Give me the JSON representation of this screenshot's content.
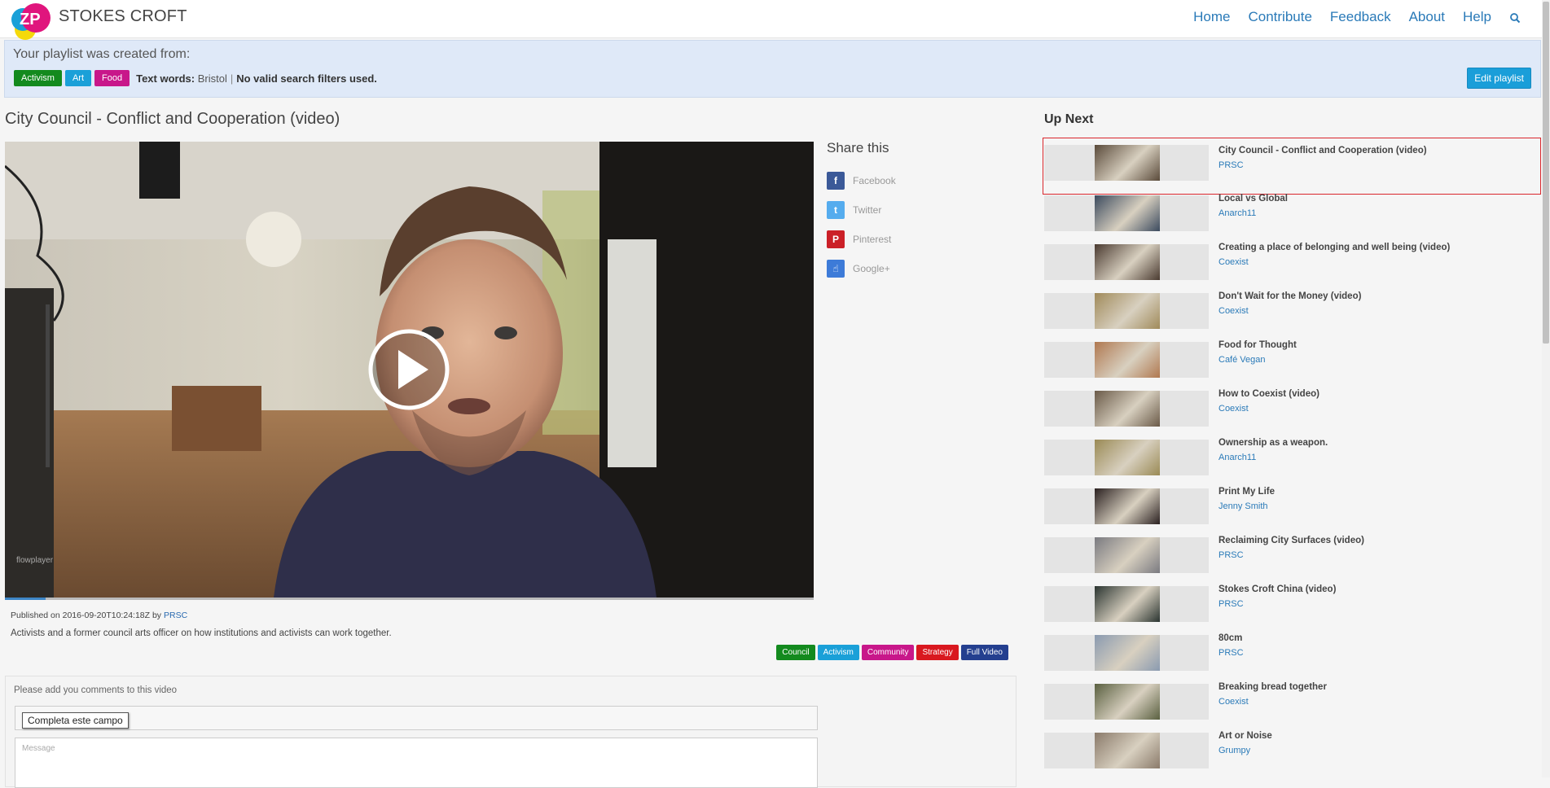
{
  "nav": {
    "brand": "STOKES CROFT",
    "links": [
      "Home",
      "Contribute",
      "Feedback",
      "About",
      "Help"
    ],
    "search_icon": "search-icon"
  },
  "banner": {
    "title": "Your playlist was created from:",
    "tags": [
      {
        "label": "Activism",
        "color": "#138a1e"
      },
      {
        "label": "Art",
        "color": "#1aa0d8"
      },
      {
        "label": "Food",
        "color": "#c8178a"
      }
    ],
    "text_words_label": "Text words:",
    "text_words_value": "Bristol",
    "separator": "|",
    "filters_note": "No valid search filters used.",
    "edit_label": "Edit playlist"
  },
  "video": {
    "title": "City Council - Conflict and Cooperation (video)",
    "watermark": "flowplayer",
    "progress": 0.05,
    "published_prefix": "Published on 2016-09-20T10:24:18Z by",
    "author": "PRSC",
    "description": "Activists and a former council arts officer on how institutions and activists can work together.",
    "tags": [
      {
        "label": "Council",
        "color": "#138a1e"
      },
      {
        "label": "Activism",
        "color": "#1aa0d8"
      },
      {
        "label": "Community",
        "color": "#c8178a"
      },
      {
        "label": "Strategy",
        "color": "#d9181f"
      },
      {
        "label": "Full Video",
        "color": "#243f8f"
      }
    ]
  },
  "share": {
    "title": "Share this",
    "items": [
      {
        "label": "Facebook",
        "icon": "facebook-icon",
        "glyph": "f",
        "color": "#3b5998"
      },
      {
        "label": "Twitter",
        "icon": "twitter-icon",
        "glyph": "t",
        "color": "#55acee"
      },
      {
        "label": "Pinterest",
        "icon": "pinterest-icon",
        "glyph": "P",
        "color": "#cb2027"
      },
      {
        "label": "Google+",
        "icon": "thumbs-up-icon",
        "glyph": "☝",
        "color": "#3d7bd8"
      }
    ]
  },
  "comments": {
    "label": "Please add you comments to this video",
    "tooltip": "Completa este campo",
    "message_placeholder": "Message"
  },
  "upnext": {
    "title": "Up Next",
    "items": [
      {
        "title": "City Council - Conflict and Cooperation (video)",
        "author": "PRSC",
        "active": true,
        "thumb": "#5a4a3a"
      },
      {
        "title": "Local vs Global",
        "author": "Anarch11",
        "active": false,
        "thumb": "#3b4a5e"
      },
      {
        "title": "Creating a place of belonging and well being (video)",
        "author": "Coexist",
        "active": false,
        "thumb": "#4a3a30"
      },
      {
        "title": "Don't Wait for the Money (video)",
        "author": "Coexist",
        "active": false,
        "thumb": "#a08a5a"
      },
      {
        "title": "Food for Thought",
        "author": "Café Vegan",
        "active": false,
        "thumb": "#b07850"
      },
      {
        "title": "How to Coexist (video)",
        "author": "Coexist",
        "active": false,
        "thumb": "#6a5a48"
      },
      {
        "title": "Ownership as a weapon.",
        "author": "Anarch11",
        "active": false,
        "thumb": "#9a8a55"
      },
      {
        "title": "Print My Life",
        "author": "Jenny Smith",
        "active": false,
        "thumb": "#2a2020"
      },
      {
        "title": "Reclaiming City Surfaces (video)",
        "author": "PRSC",
        "active": false,
        "thumb": "#7a7a80"
      },
      {
        "title": "Stokes Croft China (video)",
        "author": "PRSC",
        "active": false,
        "thumb": "#2a3430"
      },
      {
        "title": "80cm",
        "author": "PRSC",
        "active": false,
        "thumb": "#8a9ab0"
      },
      {
        "title": "Breaking bread together",
        "author": "Coexist",
        "active": false,
        "thumb": "#5a6040"
      },
      {
        "title": "Art or Noise",
        "author": "Grumpy",
        "active": false,
        "thumb": "#8a7a6a"
      }
    ]
  }
}
